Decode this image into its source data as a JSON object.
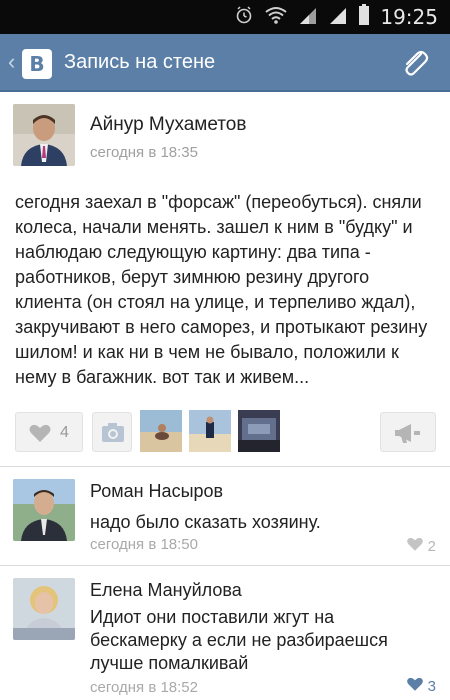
{
  "status_bar": {
    "time": "19:25",
    "icons": [
      "alarm-icon",
      "wifi-icon",
      "signal-icon",
      "signal-icon",
      "battery-icon"
    ]
  },
  "app_bar": {
    "logo": "B",
    "title": "Запись на стене",
    "action_icon": "paperclip-icon"
  },
  "post": {
    "author": "Айнур Мухаметов",
    "time": "сегодня в 18:35",
    "text": "сегодня заехал в \"форсаж\" (переобуться). сняли колеса, начали менять. зашел к ним в \"будку\" и наблюдаю следующую картину: два типа - работников, берут зимнюю резину другого клиента (он стоял на улице, и терпеливо ждал), закручивают в него саморез, и протыкают резину шилом! и как ни в чем не бывало, положили к нему в багажник. вот так и живем...",
    "likes": "4",
    "attachments": [
      "photo-thumbnail",
      "photo-thumbnail",
      "photo-thumbnail",
      "photo-thumbnail"
    ]
  },
  "comments": [
    {
      "author": "Роман Насыров",
      "text": "надо было сказать хозяину.",
      "time": "сегодня в 18:50",
      "likes": "2"
    },
    {
      "author": "Елена Мануйлова",
      "text": "Идиот они поставили жгут на бескамерку  а если не разбираешся лучше помалкивай",
      "time": "сегодня в 18:52",
      "likes": "3"
    }
  ],
  "colors": {
    "header": "#5b7fa6",
    "status_bar": "#0a0a0a",
    "accent": "#5b7fa6"
  }
}
